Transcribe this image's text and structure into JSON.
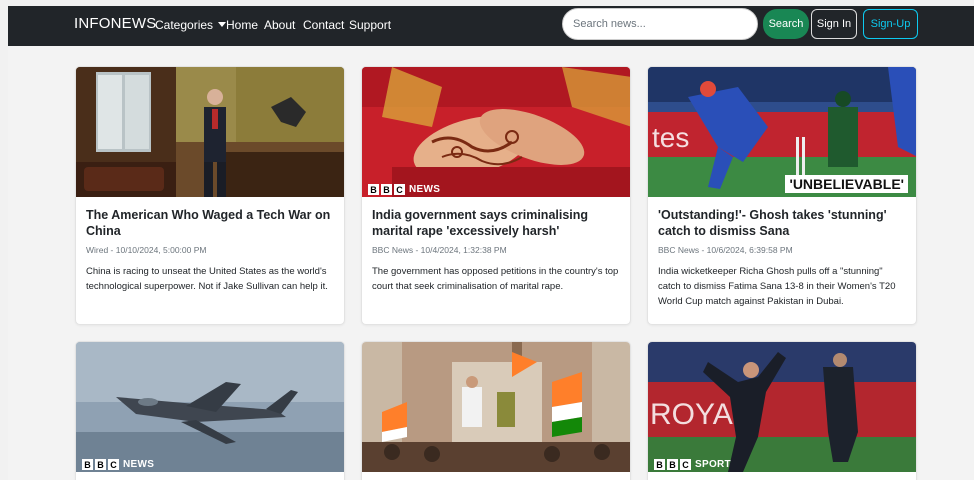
{
  "navbar": {
    "brand": "INFONEWS",
    "links": [
      "Categories",
      "Home",
      "About",
      "Contact",
      "Support"
    ],
    "search_placeholder": "Search news...",
    "search_label": "Search",
    "signin_label": "Sign In",
    "signup_label": "Sign-Up"
  },
  "articles": [
    {
      "title": "The American Who Waged a Tech War on China",
      "meta": "Wired - 10/10/2024, 5:00:00 PM",
      "description": "China is racing to unseat the United States as the world's technological superpower. Not if Jake Sullivan can help it."
    },
    {
      "title": "India government says criminalising marital rape 'excessively harsh'",
      "meta": "BBC News - 10/4/2024, 1:32:38 PM",
      "description": "The government has opposed petitions in the country's top court that seek criminalisation of marital rape.",
      "image_logo": "NEWS"
    },
    {
      "title": "'Outstanding!'- Ghosh takes 'stunning' catch to dismiss Sana",
      "meta": "BBC News - 10/6/2024, 6:39:58 PM",
      "description": "India wicketkeeper Richa Ghosh pulls off a \"stunning\" catch to dismiss Fatima Sana 13-8 in their Women's T20 World Cup match against Pakistan in Dubai.",
      "image_overlay": "'UNBELIEVABLE'"
    },
    {
      "image_logo": "NEWS"
    },
    {},
    {
      "image_logo": "SPORT"
    }
  ],
  "colors": {
    "navbar": "#212529",
    "search_button": "#198754",
    "signup_border": "#0dcaf0"
  }
}
